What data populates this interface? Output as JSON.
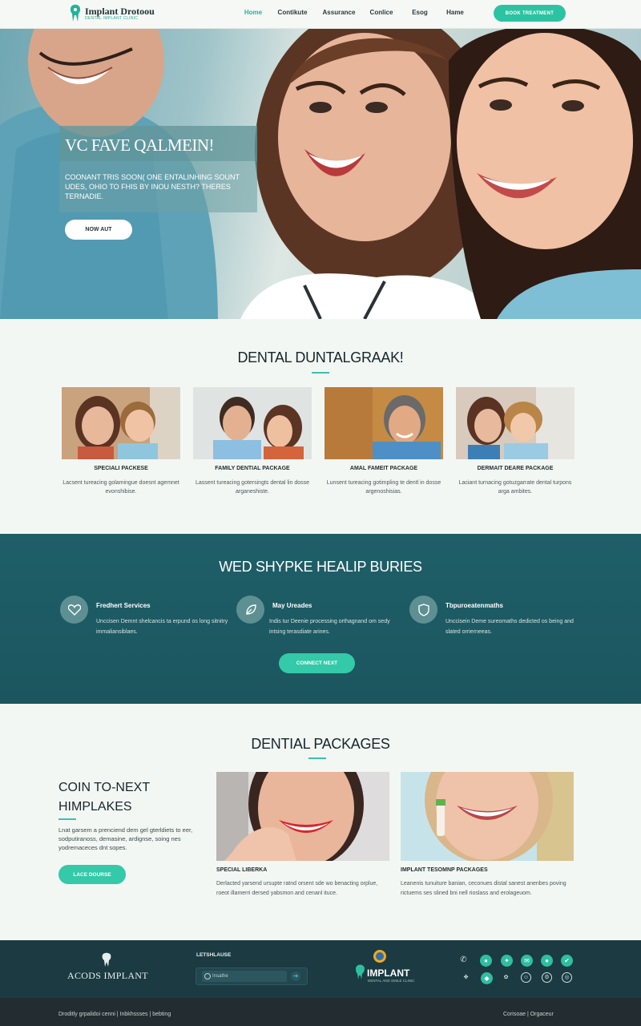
{
  "header": {
    "logo_name": "Implant Drotoou",
    "logo_tagline": "DENTAL IMPLANT CLINIC",
    "nav": [
      {
        "label": "Home",
        "active": true
      },
      {
        "label": "Contikute",
        "active": false
      },
      {
        "label": "Assurance",
        "active": false
      },
      {
        "label": "Conlice",
        "active": false
      },
      {
        "label": "Esog",
        "active": false
      },
      {
        "label": "Hame",
        "active": false
      }
    ],
    "cta_label": "BOOK TREATMENT"
  },
  "hero": {
    "title": "VC FAVE QALMEIN!",
    "text": "COONANT TRIS SOON( ONE ENTALINHING SOUNT UDES, OHIO TO FHIS BY INOU NESTH? THERES TERNADIE.",
    "button_label": "NOW AUT"
  },
  "section1": {
    "title": "DENTAL DUNTALGRAAK!",
    "cards": [
      {
        "title": "SPECIALI PACKESE",
        "desc": "Lacsent tureacing golamingue doesnt agemnet evonshibise."
      },
      {
        "title": "FAMILY DENTIAL PACKAGE",
        "desc": "Lassent tureacing gotersingts dental lin dosse arganeshiste."
      },
      {
        "title": "AMAL FAMEIT PACKAGE",
        "desc": "Lunsent tureacing gotimpling te dentl in dosse argenoshisias."
      },
      {
        "title": "DERMAIT DEARE PACKAGE",
        "desc": "Laciant turnacing gotuzgarrate dental turpons arga ambites."
      }
    ]
  },
  "band": {
    "title": "WED SHYPKE HEALIP BURIES",
    "features": [
      {
        "title": "Fredhert Services",
        "desc": "Unccisen Demnt shelcancis ta erpund os long sitnitry immaliansiblaes."
      },
      {
        "title": "May Ureades",
        "desc": "Indis tur Deenie processing orthagnand om sedy intsing terasdiate arines."
      },
      {
        "title": "Tbpuroeatenmaths",
        "desc": "Unccisein Deme sureomaths dedicted os being and slated orrierneeas."
      }
    ],
    "button_label": "CONNECT NEXT"
  },
  "packages": {
    "title": "DENTIAL PACKAGES",
    "side_heading_line1": "COIN TO-NEXT",
    "side_heading_line2": "HIMPLAKES",
    "side_text": "Lnat garsem a prenciend dem gel gterldiets to eer, sodputiranoss, demasine, ardignse, soing nes yodremaceces dnt sopes.",
    "side_button": "LACE DOURSE",
    "items": [
      {
        "title": "SPECIAL LIBERKA",
        "desc": "Derlacted yarsend ursupte ratnd orsent sde wo benacting orplue, roeot illamerri dersed yabsmon and cenanl ituce."
      },
      {
        "title": "IMPLANT TESOMNP PACKAGES",
        "desc": "Leanenis tunuiture banian, ceconues distal sanest anenbes poving rictuems ses slined bni nell rioslass and erolageuom."
      }
    ]
  },
  "footer": {
    "brand": "ACODS IMPLANT",
    "newsletter_label": "LETSHLAUSE",
    "search_placeholder": "Insathe",
    "center_brand": "IMPLANT",
    "center_sub": "DENTAL AND SMILE CLINIC",
    "bottom_left": "Droditly grpalidoi cenni  |  Inbkhssses  |  bebting",
    "bottom_right": "Corisoae  |  Orgaceur"
  },
  "colors": {
    "accent": "#2cc3a2",
    "band": "#1f5f68",
    "footer": "#1b3a42"
  },
  "icons": [
    "tooth-logo-icon",
    "heart-tooth-icon",
    "leaf-icon",
    "shield-icon",
    "phone-icon",
    "social-icons"
  ]
}
